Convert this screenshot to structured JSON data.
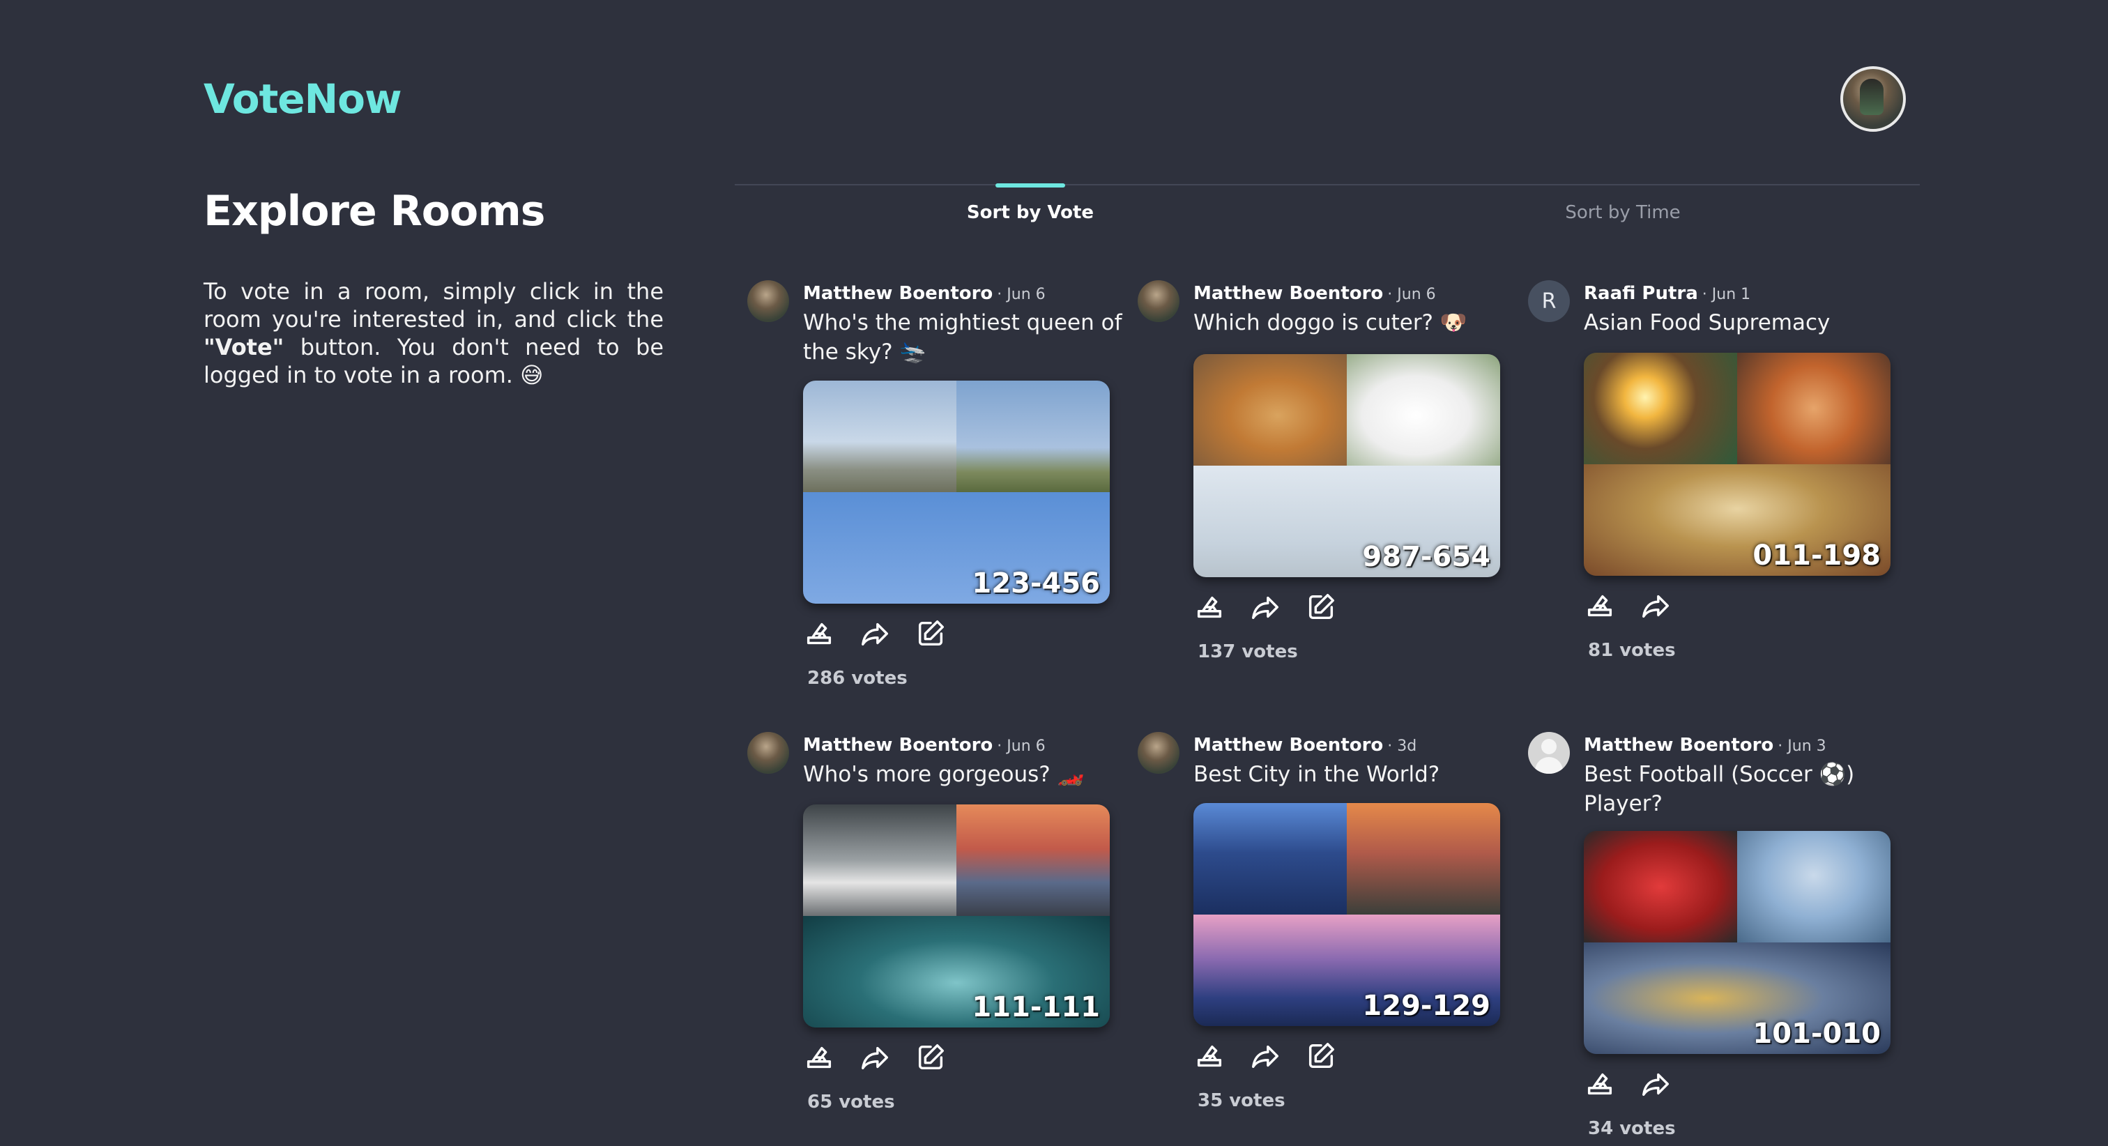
{
  "header": {
    "logo": "VoteNow",
    "avatar_icon": "user-avatar"
  },
  "intro": {
    "title": "Explore Rooms",
    "desc_before": "To vote in a room, simply click in the room you're interested in, and click the ",
    "desc_bold": "\"Vote\"",
    "desc_after": " button. You don't need to be logged in to vote in a room. 😅"
  },
  "tabs": {
    "active": "Sort by Vote",
    "inactive": "Sort by Time"
  },
  "colors": {
    "background": "#2e313d",
    "accent": "#6ee7e0",
    "muted_text": "#9a9ea9"
  },
  "rooms": [
    {
      "author": "Matthew Boentoro",
      "date": "· Jun 6",
      "question": "Who's the mightiest queen of the sky? 🛬",
      "code": "123-456",
      "votes": "286 votes",
      "editable": true
    },
    {
      "author": "Matthew Boentoro",
      "date": "· Jun 6",
      "question": "Which doggo is cuter? 🐶",
      "code": "987-654",
      "votes": "137 votes",
      "editable": true
    },
    {
      "author": "Raafi Putra",
      "date": "· Jun 1",
      "avatar_letter": "R",
      "question": "Asian Food Supremacy",
      "code": "011-198",
      "votes": "81 votes",
      "editable": false
    },
    {
      "author": "Matthew Boentoro",
      "date": "· Jun 6",
      "question": "Who's more gorgeous? 🏎️",
      "code": "111-111",
      "votes": "65 votes",
      "editable": true
    },
    {
      "author": "Matthew Boentoro",
      "date": "· 3d",
      "question": "Best City in the World?",
      "code": "129-129",
      "votes": "35 votes",
      "editable": true
    },
    {
      "author": "Matthew Boentoro",
      "date": "· Jun 3",
      "question": "Best Football (Soccer ⚽) Player?",
      "code": "101-010",
      "votes": "34 votes",
      "editable": false
    }
  ]
}
